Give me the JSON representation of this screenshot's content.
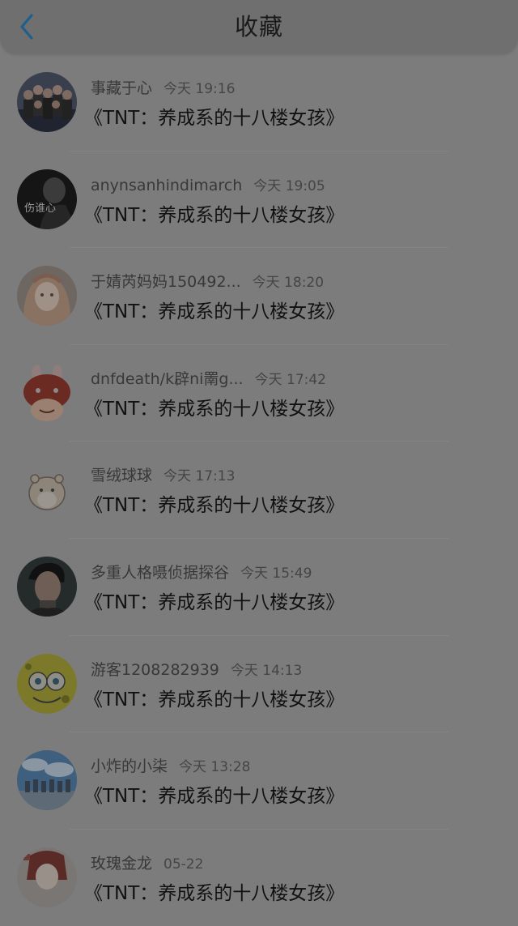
{
  "header": {
    "title": "收藏",
    "back_icon": "chevron-left-icon",
    "accent_color": "#1e5f8c"
  },
  "favorites": [
    {
      "username": "事藏于心",
      "time": "今天 19:16",
      "title": "《TNT：养成系的十八楼女孩》",
      "avatar": "group-photo"
    },
    {
      "username": "anynsanhindimarch",
      "time": "今天 19:05",
      "title": "《TNT：养成系的十八楼女孩》",
      "avatar": "dark-portrait"
    },
    {
      "username": "于婧芮妈妈150492...",
      "time": "今天 18:20",
      "title": "《TNT：养成系的十八楼女孩》",
      "avatar": "anime-girl"
    },
    {
      "username": "dnfdeath/k辟ni罱g...",
      "time": "今天 17:42",
      "title": "《TNT：养成系的十八楼女孩》",
      "avatar": "bunny-character"
    },
    {
      "username": "雪绒球球",
      "time": "今天 17:13",
      "title": "《TNT：养成系的十八楼女孩》",
      "avatar": "hamster"
    },
    {
      "username": "多重人格嗫侦据探谷",
      "time": "今天 15:49",
      "title": "《TNT：养成系的十八楼女孩》",
      "avatar": "man-portrait"
    },
    {
      "username": "游客1208282939",
      "time": "今天 14:13",
      "title": "《TNT：养成系的十八楼女孩》",
      "avatar": "sponge-character"
    },
    {
      "username": "小炸的小柒",
      "time": "今天 13:28",
      "title": "《TNT：养成系的十八楼女孩》",
      "avatar": "sky-group"
    },
    {
      "username": "玫瑰金龙",
      "time": "05-22",
      "title": "《TNT：养成系的十八楼女孩》",
      "avatar": "illustration"
    }
  ]
}
